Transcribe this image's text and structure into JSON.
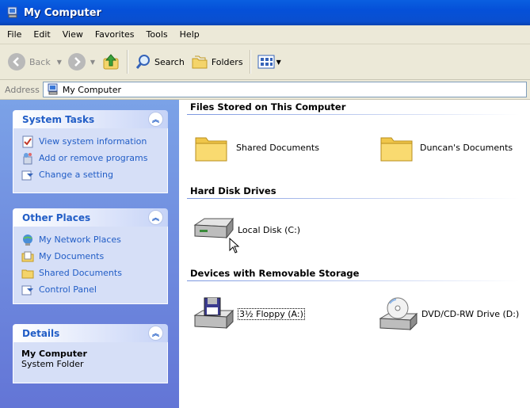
{
  "window": {
    "title": "My Computer"
  },
  "menu": [
    "File",
    "Edit",
    "View",
    "Favorites",
    "Tools",
    "Help"
  ],
  "toolbar": {
    "back_label": "Back",
    "search_label": "Search",
    "folders_label": "Folders"
  },
  "address": {
    "label": "Address",
    "value": "My Computer"
  },
  "system_tasks": {
    "title": "System Tasks",
    "items": [
      "View system information",
      "Add or remove programs",
      "Change a setting"
    ]
  },
  "other_places": {
    "title": "Other Places",
    "items": [
      "My Network Places",
      "My Documents",
      "Shared Documents",
      "Control Panel"
    ]
  },
  "details": {
    "title": "Details",
    "name": "My Computer",
    "type": "System Folder"
  },
  "groups": {
    "files": {
      "title": "Files Stored on This Computer",
      "items": [
        "Shared Documents",
        "Duncan's Documents"
      ]
    },
    "hard_disks": {
      "title": "Hard Disk Drives",
      "items": [
        "Local Disk (C:)"
      ]
    },
    "removable": {
      "title": "Devices with Removable Storage",
      "items": [
        "3½ Floppy (A:)",
        "DVD/CD-RW Drive (D:)"
      ]
    }
  },
  "colors": {
    "titlebar": "#0550d8",
    "task_link": "#215dc6",
    "pane_bg": "#7ba2e7"
  }
}
